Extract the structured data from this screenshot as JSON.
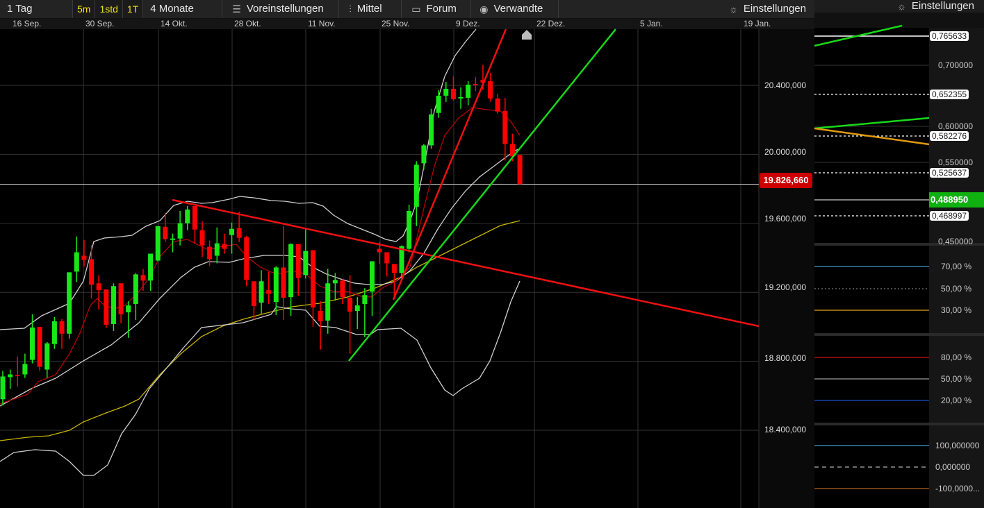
{
  "toolbar": {
    "period": "1 Tag",
    "intervals": [
      "5m",
      "1std",
      "1T"
    ],
    "range": "4 Monate",
    "presets": "Voreinstellungen",
    "indicator": "Mittel",
    "forum": "Forum",
    "related": "Verwandte",
    "settings": "Einstellungen"
  },
  "right_panel": {
    "settings": "Einstellungen",
    "axis_labels": [
      "0,700000",
      "0,600000",
      "0,550000",
      "0,450000"
    ],
    "level_boxes": [
      "0,765633",
      "0,652355",
      "0,582276",
      "0,525637",
      "0,468997"
    ],
    "current": "0,488950",
    "osc1": [
      "70,00 %",
      "50,00 %",
      "30,00 %"
    ],
    "osc2": [
      "80,00 %",
      "50,00 %",
      "20,00 %"
    ],
    "osc3": [
      "100,000000",
      "0,000000",
      "-100,0000..."
    ]
  },
  "chart_data": {
    "type": "candlestick",
    "value_scale": 1000,
    "x_ticks": [
      "16 Sep.",
      "30 Sep.",
      "14 Okt.",
      "28 Okt.",
      "11 Nov.",
      "25 Nov.",
      "9 Dez.",
      "22 Dez.",
      "5 Jan.",
      "19 Jan."
    ],
    "y_ticks": [
      20400,
      20000,
      19600,
      19200,
      18800,
      18400
    ],
    "y_tick_labels": [
      "20.400,000",
      "20.000,000",
      "19.600,000",
      "19.200,000",
      "18.800,000",
      "18.400,000"
    ],
    "ylim": [
      18250,
      20900
    ],
    "current_price": 19826.66,
    "current_price_label": "19.826,660",
    "colors": {
      "up": "#18e818",
      "down": "#ff0000"
    },
    "candles_ohlc": [
      [
        18580,
        18744,
        18544,
        18712
      ],
      [
        18708,
        18752,
        18640,
        18724
      ],
      [
        18720,
        18828,
        18652,
        18716
      ],
      [
        18724,
        18844,
        18704,
        18784
      ],
      [
        18808,
        19072,
        18788,
        18996
      ],
      [
        19000,
        19000,
        18744,
        18768
      ],
      [
        18752,
        18912,
        18704,
        18904
      ],
      [
        18900,
        19056,
        18872,
        19032
      ],
      [
        19032,
        19044,
        18872,
        18960
      ],
      [
        18960,
        19316,
        18932,
        19316
      ],
      [
        19320,
        19524,
        19260,
        19432
      ],
      [
        19412,
        19504,
        19348,
        19388
      ],
      [
        19392,
        19472,
        19164,
        19244
      ],
      [
        19252,
        19300,
        19100,
        19212
      ],
      [
        19216,
        19216,
        18992,
        19012
      ],
      [
        19016,
        19252,
        18976,
        19236
      ],
      [
        19252,
        19252,
        19020,
        19072
      ],
      [
        19084,
        19148,
        18936,
        19124
      ],
      [
        19132,
        19312,
        19040,
        19304
      ],
      [
        19300,
        19336,
        19208,
        19268
      ],
      [
        19268,
        19424,
        19208,
        19424
      ],
      [
        19384,
        19584,
        19380,
        19584
      ],
      [
        19580,
        19660,
        19492,
        19508
      ],
      [
        19504,
        19540,
        19432,
        19512
      ],
      [
        19512,
        19672,
        19472,
        19600
      ],
      [
        19600,
        19700,
        19560,
        19680
      ],
      [
        19700,
        19700,
        19484,
        19564
      ],
      [
        19560,
        19612,
        19404,
        19472
      ],
      [
        19464,
        19500,
        19352,
        19392
      ],
      [
        19412,
        19576,
        19368,
        19484
      ],
      [
        19480,
        19540,
        19424,
        19452
      ],
      [
        19532,
        19604,
        19424,
        19568
      ],
      [
        19572,
        19668,
        19492,
        19516
      ],
      [
        19520,
        19528,
        19236,
        19272
      ],
      [
        19264,
        19264,
        19040,
        19120
      ],
      [
        19140,
        19328,
        19072,
        19264
      ],
      [
        19212,
        19320,
        19132,
        19192
      ],
      [
        19144,
        19352,
        19068,
        19344
      ],
      [
        19344,
        19584,
        19040,
        19168
      ],
      [
        19172,
        19484,
        19064,
        19480
      ],
      [
        19480,
        19480,
        19180,
        19284
      ],
      [
        19300,
        19572,
        19280,
        19440
      ],
      [
        19444,
        19444,
        19000,
        19112
      ],
      [
        19092,
        19148,
        18868,
        19032
      ],
      [
        19036,
        19336,
        18960,
        19252
      ],
      [
        19252,
        19312,
        19152,
        19272
      ],
      [
        19268,
        19276,
        19132,
        19172
      ],
      [
        19168,
        19300,
        18844,
        19088
      ],
      [
        19092,
        19172,
        18988,
        19124
      ],
      [
        19132,
        19224,
        18940,
        19184
      ],
      [
        19204,
        19380,
        19064,
        19380
      ],
      [
        19452,
        19492,
        19364,
        19432
      ],
      [
        19432,
        19432,
        19292,
        19368
      ],
      [
        19364,
        19364,
        19160,
        19312
      ],
      [
        19312,
        19472,
        19280,
        19468
      ],
      [
        19452,
        19708,
        19432,
        19672
      ],
      [
        19696,
        19960,
        19584,
        19940
      ],
      [
        19948,
        20060,
        19912,
        20052
      ],
      [
        20052,
        20264,
        20032,
        20232
      ],
      [
        20240,
        20372,
        20212,
        20340
      ],
      [
        20340,
        20420,
        20304,
        20380
      ],
      [
        20380,
        20452,
        20312,
        20320
      ],
      [
        20324,
        20388,
        20264,
        20332
      ],
      [
        20328,
        20424,
        20284,
        20404
      ],
      [
        20408,
        20448,
        20368,
        20404
      ],
      [
        20432,
        20520,
        20372,
        20416
      ],
      [
        20424,
        20472,
        20304,
        20324
      ],
      [
        20324,
        20352,
        20236,
        20248
      ],
      [
        20252,
        20328,
        19964,
        20060
      ],
      [
        20060,
        20120,
        19960,
        19988
      ],
      [
        19996,
        19996,
        19827,
        19827
      ]
    ]
  }
}
